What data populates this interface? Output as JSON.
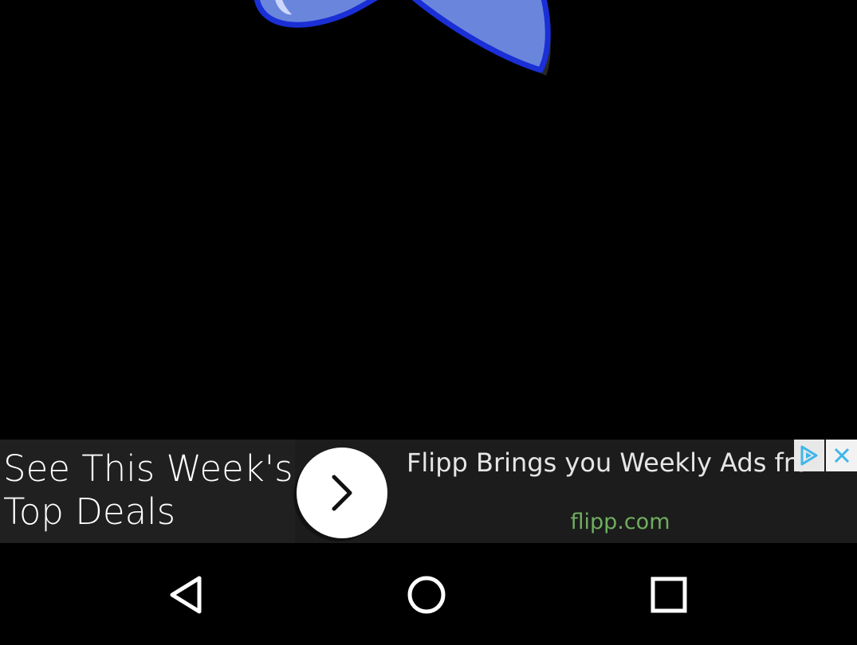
{
  "ad": {
    "headline": "See This Week's Top Deals",
    "body": "Flipp Brings you Weekly Ads from Your Favorite Local Retailers.",
    "domain": "flipp.com",
    "cta_icon": "chevron-right-icon",
    "adchoices_icon": "adchoices-icon",
    "close_icon": "close-icon"
  },
  "app": {
    "graphic": "blue-star-graphic"
  },
  "nav": {
    "back_icon": "back-icon",
    "home_icon": "home-icon",
    "recents_icon": "recents-icon"
  },
  "colors": {
    "background": "#000000",
    "star_fill": "#6a86dc",
    "star_stroke": "#1a2fd6",
    "ad_background": "#1c1c1c",
    "ad_domain": "#6fae5f",
    "adchoices": "#3fb6e8"
  }
}
